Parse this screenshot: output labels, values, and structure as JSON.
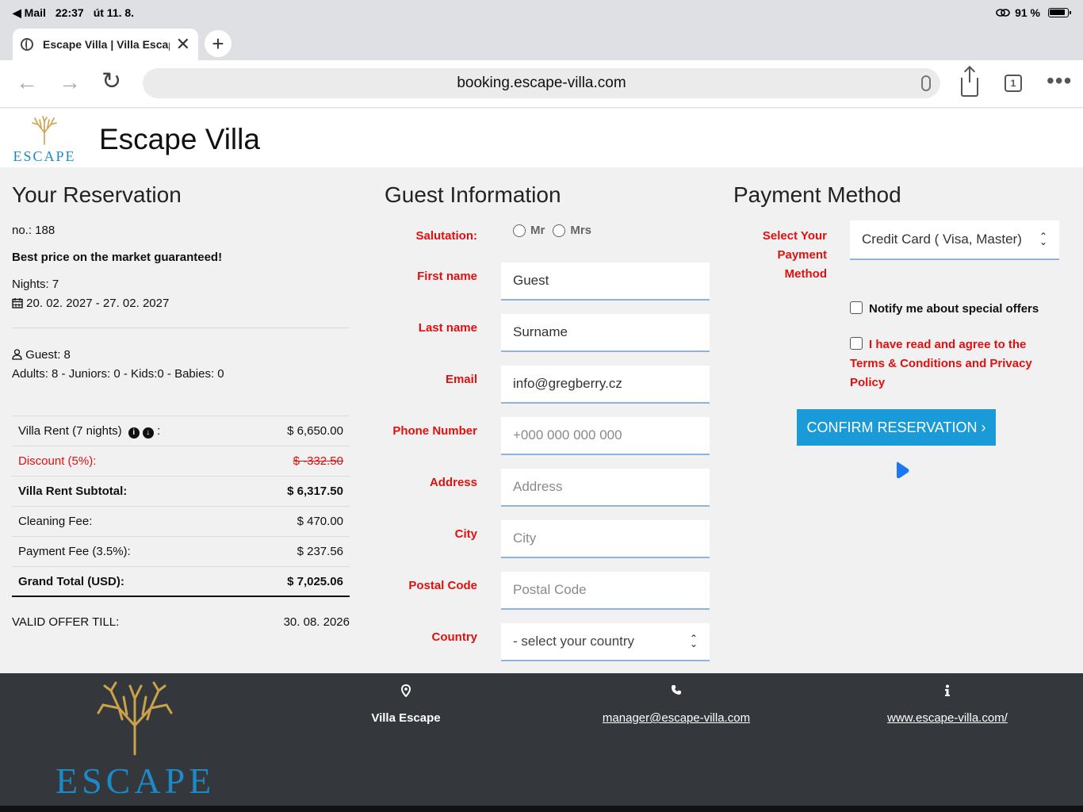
{
  "statusbar": {
    "back_app": "◀ Mail",
    "time": "22:37",
    "date": "út 11. 8.",
    "battery": "91 %"
  },
  "browser": {
    "tab_title": "Escape Villa | Villa Escape",
    "url": "booking.escape-villa.com",
    "tabs_count": "1"
  },
  "site": {
    "logo_word": "ESCAPE",
    "brand": "Escape Villa"
  },
  "reservation": {
    "title": "Your Reservation",
    "number": "no.: 188",
    "guarantee": "Best price on the market guaranteed!",
    "nights": "Nights: 7",
    "dates": "20. 02. 2027 - 27. 02. 2027",
    "guests": "Guest: 8",
    "guest_breakdown": "Adults: 8 - Juniors: 0 - Kids:0 - Babies: 0",
    "rows": [
      {
        "label": "Villa Rent (7 nights)",
        "value": "$ 6,650.00"
      },
      {
        "label": "Discount (5%):",
        "value": "$ -332.50"
      },
      {
        "label": "Villa Rent Subtotal:",
        "value": "$ 6,317.50"
      },
      {
        "label": "Cleaning Fee:",
        "value": "$ 470.00"
      },
      {
        "label": "Payment Fee (3.5%):",
        "value": "$ 237.56"
      },
      {
        "label": "Grand Total (USD):",
        "value": "$ 7,025.06"
      }
    ],
    "valid_label": "VALID OFFER TILL:",
    "valid_date": "30. 08. 2026"
  },
  "guest": {
    "title": "Guest Information",
    "salutation_label": "Salutation:",
    "salutation_options": [
      "Mr",
      "Mrs"
    ],
    "first_name_label": "First name",
    "first_name_value": "Guest",
    "last_name_label": "Last name",
    "last_name_value": "Surname",
    "email_label": "Email",
    "email_value": "info@gregberry.cz",
    "phone_label": "Phone Number",
    "phone_placeholder": "+000 000 000 000",
    "address_label": "Address",
    "address_placeholder": "Address",
    "city_label": "City",
    "city_placeholder": "City",
    "postal_label": "Postal Code",
    "postal_placeholder": "Postal Code",
    "country_label": "Country",
    "country_value": "- select your country"
  },
  "payment": {
    "title": "Payment Method",
    "select_label": "Select Your Payment Method",
    "method_value": "Credit Card ( Visa, Master)",
    "notify_label": "Notify me about special offers",
    "terms_label": "I have read and agree to the Terms & Conditions and Privacy Policy",
    "confirm_label": "CONFIRM RESERVATION ›"
  },
  "footer": {
    "logo_word": "ESCAPE",
    "location": "Villa Escape",
    "email": "manager@escape-villa.com",
    "website": "www.escape-villa.com/"
  },
  "colors": {
    "accent": "#1a9ad6",
    "label_red": "#e01010",
    "footer_bg": "#34373c",
    "logo_blue": "#1b8ac7",
    "logo_gold": "#c9a24a"
  }
}
